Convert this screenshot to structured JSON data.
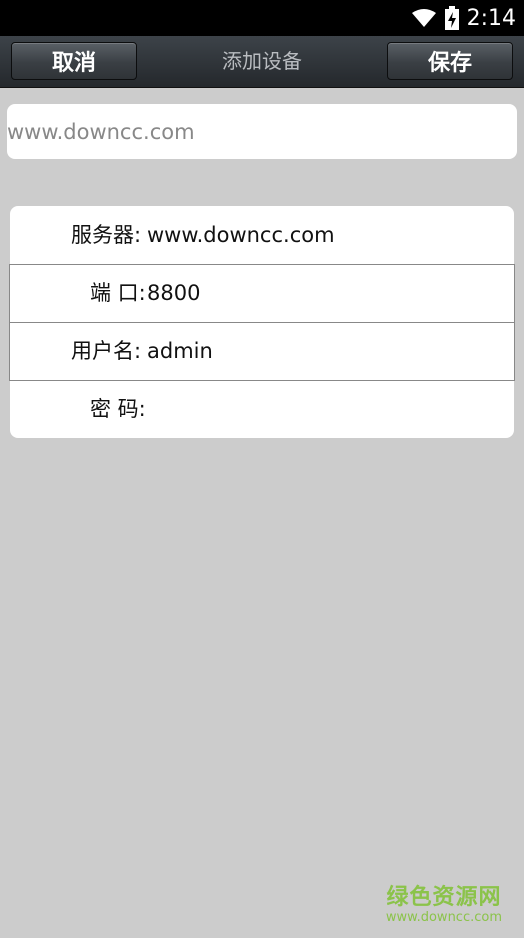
{
  "status_bar": {
    "time": "2:14",
    "icons": [
      "wifi-icon",
      "battery-charging-icon"
    ]
  },
  "title_bar": {
    "title": "添加设备",
    "cancel_label": "取消",
    "save_label": "保存"
  },
  "name_field": {
    "value": "www.downcc.com"
  },
  "form": {
    "rows": [
      {
        "label": "服务器:",
        "value": "www.downcc.com"
      },
      {
        "label": "端 口:",
        "value": "8800"
      },
      {
        "label": "用户名:",
        "value": "admin"
      },
      {
        "label": "密 码:",
        "value": ""
      }
    ]
  },
  "watermark": {
    "name": "绿色资源网",
    "url": "www.downcc.com",
    "color": "#8bc34a"
  },
  "colors": {
    "background": "#cccccc",
    "status_bar": "#000000",
    "title_bar": "#2f3337"
  }
}
